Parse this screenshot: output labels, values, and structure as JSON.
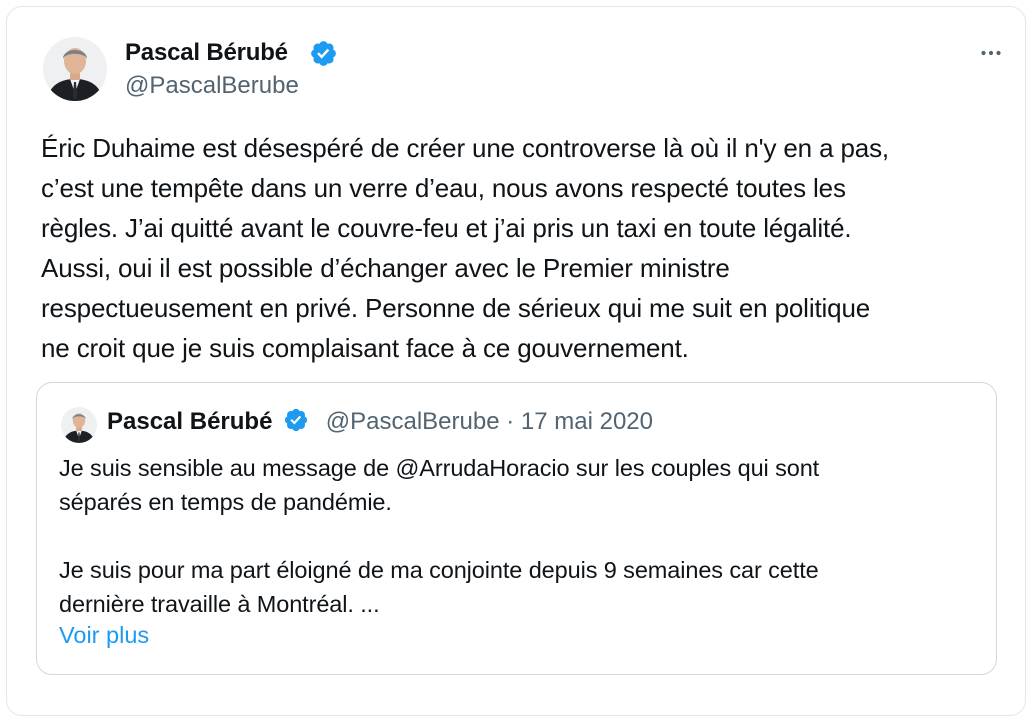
{
  "tweet": {
    "author_name": "Pascal Bérubé",
    "author_handle": "@PascalBerube",
    "verified_icon": "verified-badge-icon",
    "more_icon": "more-options-icon",
    "lines": [
      "Éric Duhaime est désespéré de créer une controverse là où il n'y en a pas,",
      "c’est une tempête dans un verre d’eau, nous avons respecté toutes les",
      "règles. J’ai quitté avant le couvre-feu et j’ai pris un taxi en toute légalité.",
      "Aussi, oui il est possible d’échanger avec le Premier ministre",
      "respectueusement en privé. Personne de sérieux qui me suit en politique",
      "ne croit que je suis complaisant face à ce gouvernement."
    ]
  },
  "quoted": {
    "author_name": "Pascal Bérubé",
    "author_handle": "@PascalBerube",
    "separator": " · ",
    "date": "17 mai 2020",
    "paragraph1_lines": [
      "Je suis sensible au message de @ArrudaHoracio sur les couples qui sont",
      "séparés en temps de pandémie."
    ],
    "paragraph2_lines": [
      "Je suis pour ma part éloigné de ma conjointe depuis 9 semaines car cette",
      "dernière travaille à Montréal. ..."
    ],
    "show_more": "Voir plus"
  },
  "colors": {
    "text": "#0f1419",
    "secondary": "#536471",
    "link": "#1d9bf0",
    "border": "#cfd9de",
    "verified": "#1d9bf0"
  }
}
